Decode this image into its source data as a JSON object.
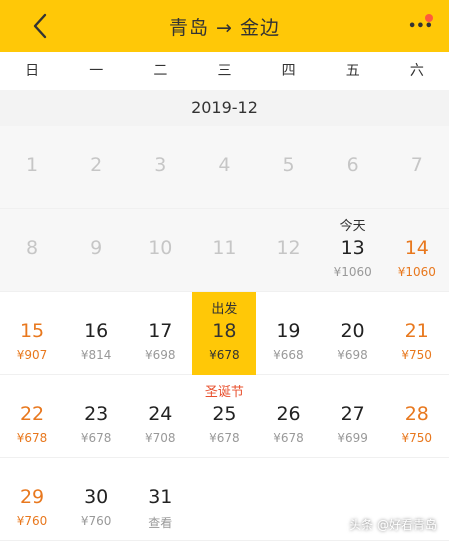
{
  "header": {
    "title": "青岛 → 金边",
    "more_icon": "more-dots-icon",
    "back_icon": "back-arrow-icon",
    "colors": {
      "header_bg": "#ffc807",
      "accent_orange": "#e8781e",
      "badge_red": "#ff5a3c"
    }
  },
  "weekdays": [
    "日",
    "一",
    "二",
    "三",
    "四",
    "五",
    "六"
  ],
  "month": "2019-12",
  "days": [
    {
      "num": "1",
      "above": "",
      "price": ""
    },
    {
      "num": "2",
      "above": "",
      "price": ""
    },
    {
      "num": "3",
      "above": "",
      "price": ""
    },
    {
      "num": "4",
      "above": "",
      "price": ""
    },
    {
      "num": "5",
      "above": "",
      "price": ""
    },
    {
      "num": "6",
      "above": "",
      "price": ""
    },
    {
      "num": "7",
      "above": "",
      "price": ""
    },
    {
      "num": "8",
      "above": "",
      "price": ""
    },
    {
      "num": "9",
      "above": "",
      "price": ""
    },
    {
      "num": "10",
      "above": "",
      "price": ""
    },
    {
      "num": "11",
      "above": "",
      "price": ""
    },
    {
      "num": "12",
      "above": "",
      "price": ""
    },
    {
      "num": "13",
      "above": "今天",
      "price": "¥1060"
    },
    {
      "num": "14",
      "above": "",
      "price": "¥1060"
    },
    {
      "num": "15",
      "above": "",
      "price": "¥907"
    },
    {
      "num": "16",
      "above": "",
      "price": "¥814"
    },
    {
      "num": "17",
      "above": "",
      "price": "¥698"
    },
    {
      "num": "18",
      "above": "出发",
      "price": "¥678"
    },
    {
      "num": "19",
      "above": "",
      "price": "¥668"
    },
    {
      "num": "20",
      "above": "",
      "price": "¥698"
    },
    {
      "num": "21",
      "above": "",
      "price": "¥750"
    },
    {
      "num": "22",
      "above": "",
      "price": "¥678"
    },
    {
      "num": "23",
      "above": "",
      "price": "¥678"
    },
    {
      "num": "24",
      "above": "",
      "price": "¥708"
    },
    {
      "num": "25",
      "above": "圣诞节",
      "price": "¥678"
    },
    {
      "num": "26",
      "above": "",
      "price": "¥678"
    },
    {
      "num": "27",
      "above": "",
      "price": "¥699"
    },
    {
      "num": "28",
      "above": "",
      "price": "¥750"
    },
    {
      "num": "29",
      "above": "",
      "price": "¥760"
    },
    {
      "num": "30",
      "above": "",
      "price": "¥760"
    },
    {
      "num": "31",
      "above": "",
      "price": "查看"
    }
  ],
  "watermark": "头条 @好看青岛"
}
